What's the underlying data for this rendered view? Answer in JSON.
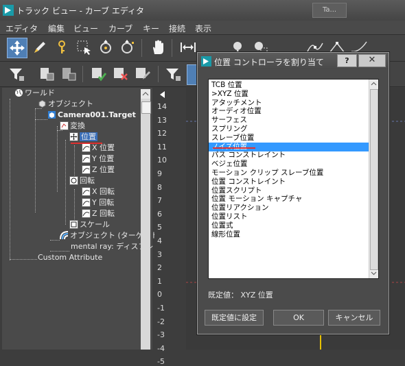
{
  "window": {
    "title": "トラック ビュー - カーブ エディタ",
    "right_button": "Ta..."
  },
  "menu": [
    "エディタ",
    "編集",
    "ビュー",
    "カーブ",
    "キー",
    "接続",
    "表示"
  ],
  "tree": {
    "world": "ワールド",
    "objects": "オブジェクト",
    "camera": "Camera001.Target",
    "transform": "変換",
    "position": "位置",
    "x_position": "X 位置",
    "y_position": "Y 位置",
    "z_position": "Z 位置",
    "rotation": "回転",
    "x_rotation": "X 回転",
    "y_rotation": "Y 回転",
    "z_rotation": "Z 回転",
    "scale": "スケール",
    "object_target": "オブジェクト (ターゲット",
    "mental_ray": "mental ray: ディスプレ",
    "custom_attribute": "Custom Attribute"
  },
  "ruler": [
    "14",
    "13",
    "12",
    "11",
    "10",
    "9",
    "8",
    "7",
    "6",
    "5",
    "4",
    "3",
    "2",
    "1",
    "0",
    "-1",
    "-2",
    "-3",
    "-4",
    "-5"
  ],
  "dialog": {
    "title": "位置 コントローラを割り当て",
    "help": "?",
    "close": "✕",
    "items": [
      "TCB 位置",
      ">XYZ 位置",
      "アタッチメント",
      "オーディオ位置",
      "サーフェス",
      "スプリング",
      "スレーブ位置",
      "ノイズ位置",
      "パス コンストレイント",
      "ベジェ位置",
      "モーション クリップ スレーブ位置",
      "位置 コンストレイント",
      "位置スクリプト",
      "位置 モーション キャプチャ",
      "位置リアクション",
      "位置リスト",
      "位置式",
      "線形位置"
    ],
    "selected_index": 7,
    "default_label": "既定値： XYZ 位置",
    "btn_set_default": "既定値に設定",
    "btn_ok": "OK",
    "btn_cancel": "キャンセル"
  }
}
